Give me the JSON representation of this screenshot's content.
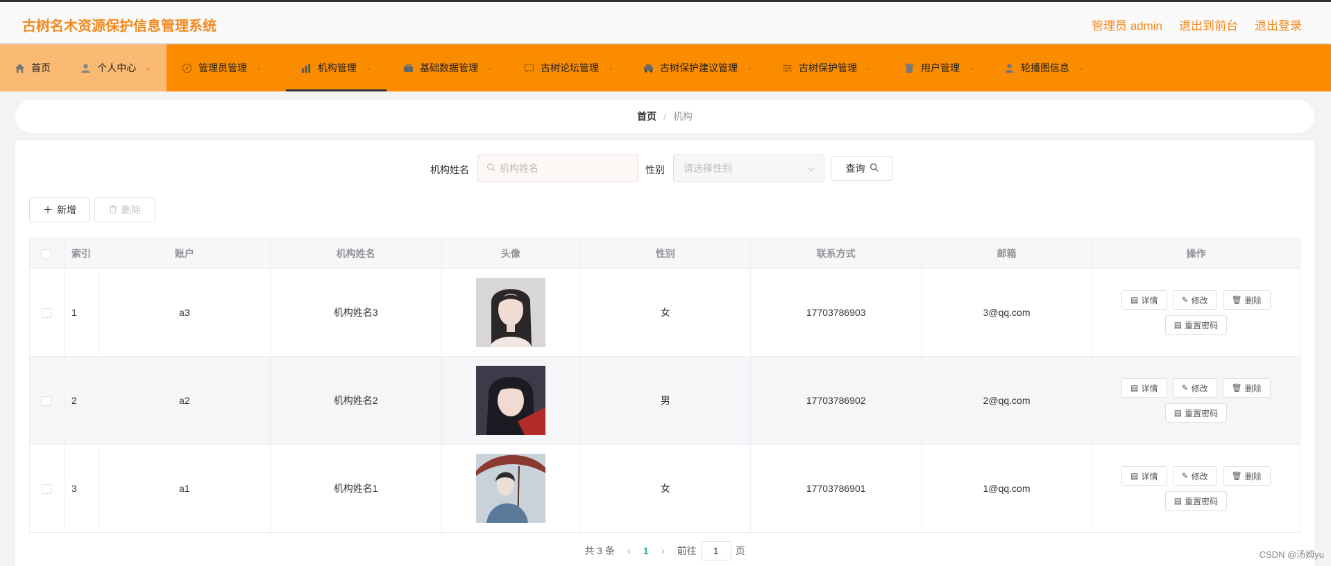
{
  "header": {
    "title": "古树名木资源保护信息管理系统",
    "admin_label": "管理员 admin",
    "front_link": "退出到前台",
    "logout_link": "退出登录"
  },
  "nav": [
    {
      "label": "首页",
      "icon": "home-icon"
    },
    {
      "label": "个人中心",
      "icon": "user-icon"
    },
    {
      "label": "管理员管理",
      "icon": "compass-icon"
    },
    {
      "label": "机构管理",
      "icon": "chart-icon"
    },
    {
      "label": "基础数据管理",
      "icon": "briefcase-icon"
    },
    {
      "label": "古树论坛管理",
      "icon": "chat-icon"
    },
    {
      "label": "古树保护建议管理",
      "icon": "car-icon"
    },
    {
      "label": "古树保护管理",
      "icon": "sliders-icon"
    },
    {
      "label": "用户管理",
      "icon": "trash-icon"
    },
    {
      "label": "轮播图信息",
      "icon": "person-icon"
    }
  ],
  "breadcrumb": {
    "home": "首页",
    "sep": "/",
    "current": "机构"
  },
  "search": {
    "name_label": "机构姓名",
    "name_placeholder": "机构姓名",
    "gender_label": "性别",
    "gender_placeholder": "请选择性别",
    "query_button": "查询"
  },
  "toolbar": {
    "add_label": "新增",
    "delete_label": "删除"
  },
  "table": {
    "headers": [
      "索引",
      "账户",
      "机构姓名",
      "头像",
      "性别",
      "联系方式",
      "邮箱",
      "操作"
    ],
    "rows": [
      {
        "index": "1",
        "account": "a3",
        "name": "机构姓名3",
        "gender": "女",
        "phone": "17703786903",
        "email": "3@qq.com"
      },
      {
        "index": "2",
        "account": "a2",
        "name": "机构姓名2",
        "gender": "男",
        "phone": "17703786902",
        "email": "2@qq.com"
      },
      {
        "index": "3",
        "account": "a1",
        "name": "机构姓名1",
        "gender": "女",
        "phone": "17703786901",
        "email": "1@qq.com"
      }
    ],
    "actions": {
      "detail": "详情",
      "edit": "修改",
      "delete": "删除",
      "reset": "重置密码"
    }
  },
  "pager": {
    "total": "共 3 条",
    "current": "1",
    "goto_label": "前往",
    "goto_value": "1",
    "page_unit": "页"
  },
  "watermark": "CSDN @汤姆yu",
  "colors": {
    "brand": "#f5891d",
    "nav_bg": "#fb8c00",
    "nav_highlight": "#fbba74",
    "pager_active": "#1bb394"
  }
}
